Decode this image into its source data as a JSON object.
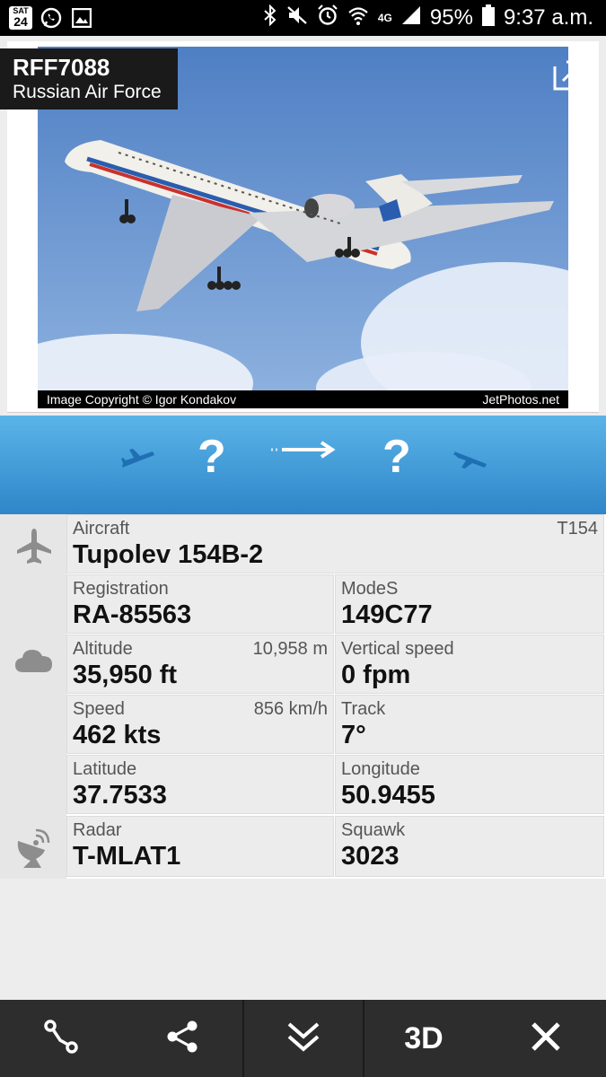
{
  "status_bar": {
    "sat_badge_top": "SAT",
    "sat_badge_num": "24",
    "network": "4G",
    "battery": "95%",
    "time": "9:37 a.m.",
    "icons": [
      "sat24-icon",
      "whatsapp-icon",
      "gallery-icon",
      "bluetooth-icon",
      "mute-icon",
      "alarm-icon",
      "wifi-icon",
      "signal-icon",
      "battery-icon"
    ]
  },
  "flight": {
    "callsign": "RFF7088",
    "airline": "Russian Air Force"
  },
  "photo": {
    "copyright": "Image Copyright © Igor Kondakov",
    "source": "JetPhotos.net"
  },
  "route": {
    "origin": "?",
    "destination": "?"
  },
  "details": {
    "aircraft": {
      "label": "Aircraft",
      "value": "Tupolev 154B-2",
      "code": "T154"
    },
    "registration": {
      "label": "Registration",
      "value": "RA-85563"
    },
    "modes": {
      "label": "ModeS",
      "value": "149C77"
    },
    "altitude": {
      "label": "Altitude",
      "value": "35,950 ft",
      "alt": "10,958 m"
    },
    "vertical_speed": {
      "label": "Vertical speed",
      "value": "0 fpm"
    },
    "speed": {
      "label": "Speed",
      "value": "462 kts",
      "alt": "856 km/h"
    },
    "track": {
      "label": "Track",
      "value": "7°"
    },
    "latitude": {
      "label": "Latitude",
      "value": "37.7533"
    },
    "longitude": {
      "label": "Longitude",
      "value": "50.9455"
    },
    "radar": {
      "label": "Radar",
      "value": "T-MLAT1"
    },
    "squawk": {
      "label": "Squawk",
      "value": "3023"
    }
  },
  "toolbar": {
    "three_d": "3D",
    "colors": {
      "bg": "#2d2d2d",
      "route_top": "#5bb4e8",
      "route_bottom": "#2f86c9"
    }
  }
}
